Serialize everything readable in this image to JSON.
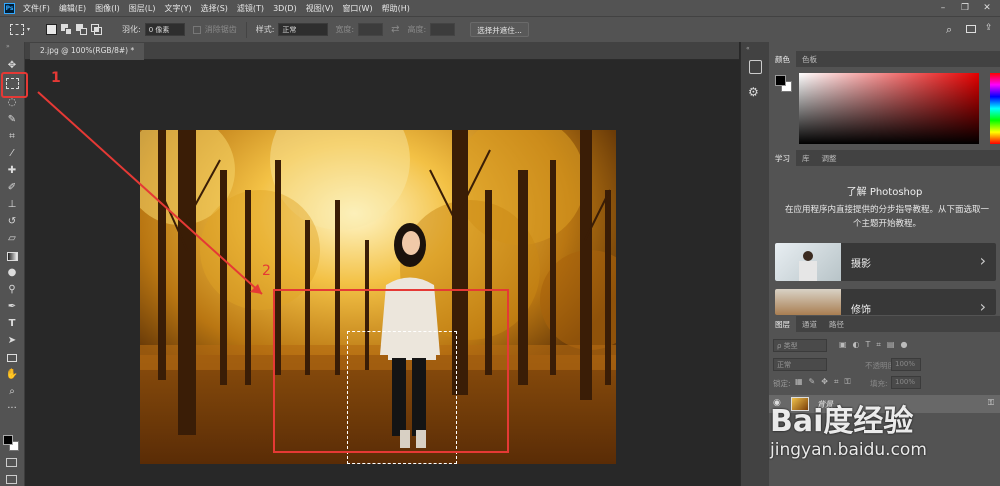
{
  "app": {
    "logo": "Ps"
  },
  "menu": [
    "文件(F)",
    "编辑(E)",
    "图像(I)",
    "图层(L)",
    "文字(Y)",
    "选择(S)",
    "滤镜(T)",
    "3D(D)",
    "视图(V)",
    "窗口(W)",
    "帮助(H)"
  ],
  "options": {
    "feather_label": "羽化:",
    "feather_value": "0 像素",
    "antialias_label": "消除锯齿",
    "style_label": "样式:",
    "style_value": "正常",
    "width_label": "宽度:",
    "height_label": "高度:",
    "select_mask_button": "选择并遮住..."
  },
  "document": {
    "tab_label": "2.jpg @ 100%(RGB/8#) *"
  },
  "annotations": {
    "label1": "1",
    "label2": "2",
    "color": "#e53935"
  },
  "panels": {
    "color": {
      "tabs": [
        "颜色",
        "色板"
      ]
    },
    "learn": {
      "tabs": [
        "学习",
        "库",
        "调整"
      ],
      "title": "了解 Photoshop",
      "description": "在应用程序内直接提供的分步指导教程。从下面选取一个主题开始教程。",
      "cards": [
        {
          "label": "摄影"
        },
        {
          "label": "修饰"
        }
      ]
    },
    "layers": {
      "tabs": [
        "图层",
        "通道",
        "路径"
      ],
      "filter_label": "ρ 类型",
      "blend_mode": "正常",
      "opacity_label": "不透明度:",
      "opacity_value": "100%",
      "lock_label": "锁定:",
      "fill_label": "填充:",
      "fill_value": "100%",
      "layer_name": "背景"
    }
  },
  "watermark": {
    "brand": "Bai度经验",
    "url": "jingyan.baidu.com"
  },
  "colors": {
    "accent": "#31a8ff",
    "annotation": "#e53935",
    "panel": "#535353",
    "canvas_bg": "#282828"
  }
}
